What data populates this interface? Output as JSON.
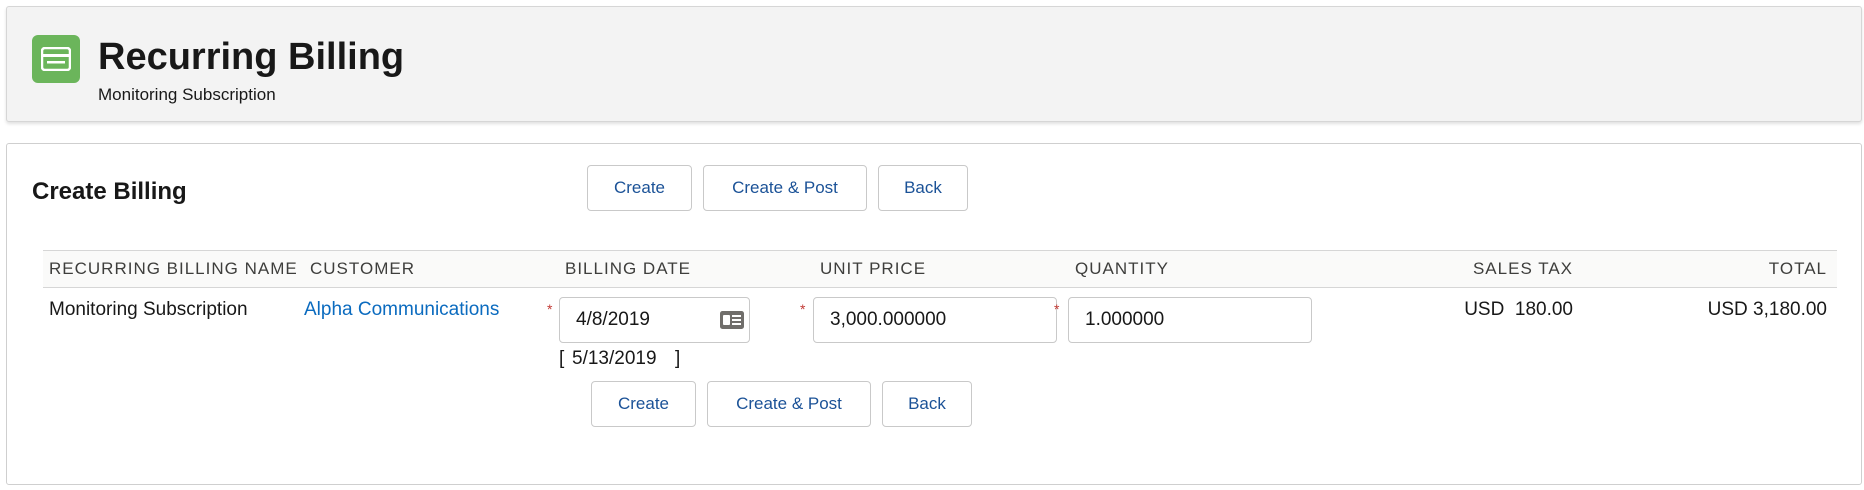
{
  "header": {
    "icon": "billing-card-icon",
    "title": "Recurring Billing",
    "subtitle": "Monitoring Subscription",
    "accent_color": "#6bb55b"
  },
  "main": {
    "section_title": "Create Billing",
    "top_buttons": {
      "create": "Create",
      "create_post": "Create & Post",
      "back": "Back"
    },
    "bottom_buttons": {
      "create": "Create",
      "create_post": "Create & Post",
      "back": "Back"
    },
    "table": {
      "headers": {
        "name": "RECURRING BILLING NAME",
        "customer": "CUSTOMER",
        "billing_date": "BILLING DATE",
        "unit_price": "UNIT PRICE",
        "quantity": "QUANTITY",
        "sales_tax": "SALES TAX",
        "total": "TOTAL"
      },
      "row": {
        "name": "Monitoring Subscription",
        "customer": "Alpha Communications",
        "billing_date": "4/8/2019",
        "bracket_open": "[",
        "suggested_date": "5/13/2019",
        "bracket_close": "]",
        "unit_price": "3,000.000000",
        "quantity": "1.000000",
        "sales_tax_currency": "USD",
        "sales_tax": "180.00",
        "total": "USD 3,180.00"
      },
      "required_marker": "*"
    }
  }
}
